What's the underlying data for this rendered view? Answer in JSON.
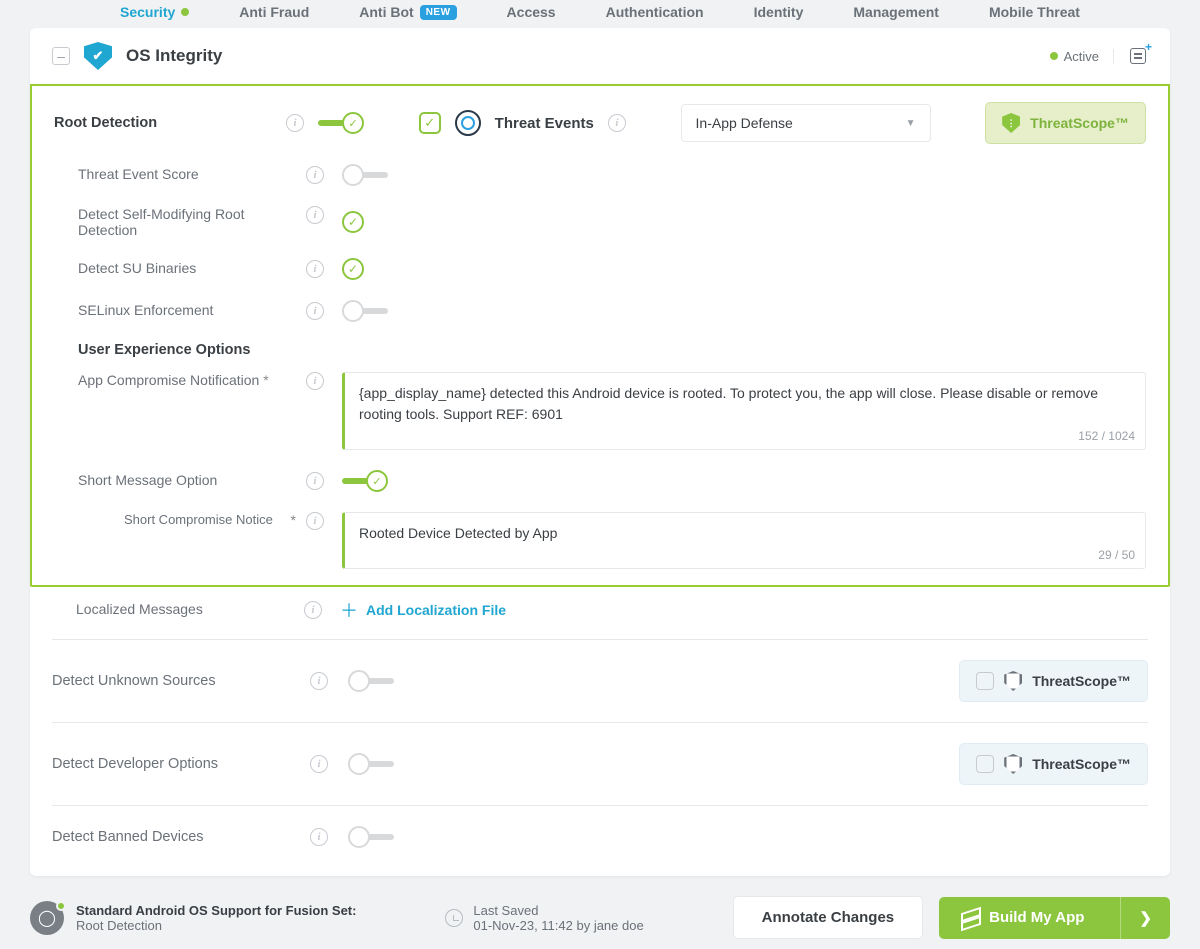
{
  "nav": {
    "tabs": [
      "Security",
      "Anti Fraud",
      "Anti Bot",
      "Access",
      "Authentication",
      "Identity",
      "Management",
      "Mobile Threat"
    ],
    "active": "Security",
    "new_badge_on": "Anti Bot",
    "new_badge_text": "NEW"
  },
  "card": {
    "title": "OS Integrity",
    "status": "Active"
  },
  "section": {
    "root_label": "Root Detection",
    "threat_events_label": "Threat Events",
    "defense_select": "In-App Defense",
    "threatscope_label": "ThreatScope™",
    "rows": {
      "score": "Threat Event Score",
      "self_mod": "Detect Self-Modifying Root Detection",
      "su": "Detect SU Binaries",
      "selinux": "SELinux Enforcement"
    },
    "ux_title": "User Experience Options",
    "notif_label": "App Compromise Notification",
    "notif_value": "{app_display_name} detected this Android device is rooted. To protect you, the app will close. Please disable or remove rooting tools. Support REF: 6901",
    "notif_count": "152 / 1024",
    "short_opt": "Short Message Option",
    "short_notice_label": "Short Compromise Notice",
    "short_notice_value": "Rooted Device Detected by App",
    "short_notice_count": "29 / 50",
    "localized": "Localized Messages",
    "add_local": "Add Localization File"
  },
  "lower": {
    "unknown": "Detect Unknown Sources",
    "devopts": "Detect Developer Options",
    "banned": "Detect Banned Devices",
    "threatscope_label": "ThreatScope™"
  },
  "footer": {
    "fusion_title": "Standard Android OS Support for Fusion Set:",
    "fusion_sub": "Root Detection",
    "saved_label": "Last Saved",
    "saved_value": "01-Nov-23, 11:42 by jane doe",
    "annotate": "Annotate Changes",
    "build": "Build My App"
  }
}
